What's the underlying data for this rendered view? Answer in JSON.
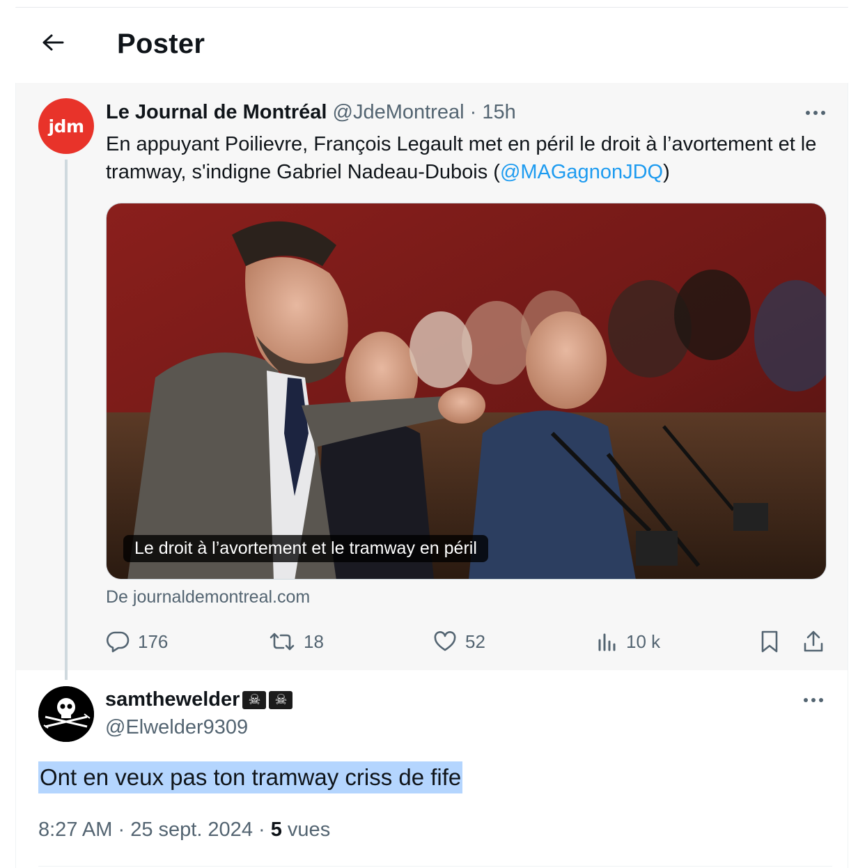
{
  "header": {
    "title": "Poster",
    "back_icon": "arrow-left-icon"
  },
  "parent_tweet": {
    "avatar_text": "jdm",
    "avatar_color": "#e8332a",
    "display_name": "Le Journal de Montréal",
    "handle": "@JdeMontreal",
    "separator": "·",
    "time": "15h",
    "text_before": "En appuyant Poilievre, François Legault met en péril le droit à l’avortement et le tramway, s'indigne Gabriel Nadeau-Dubois (",
    "mention": "@MAGagnonJDQ",
    "text_after": ")",
    "media_caption": "Le droit à l’avortement et le tramway en péril",
    "source": "De journaldemontreal.com",
    "actions": {
      "replies": "176",
      "reposts": "18",
      "likes": "52",
      "views": "10 k"
    }
  },
  "reply_tweet": {
    "display_name": "samthewelder",
    "flag_emoji": "☠",
    "handle": "@Elwelder9309",
    "text": "Ont en veux pas ton tramway criss de fife",
    "time": "8:27 AM",
    "sep1": " · ",
    "date": "25 sept. 2024",
    "sep2": " · ",
    "views_count": "5",
    "views_label": " vues"
  },
  "colors": {
    "link": "#1d9bf0",
    "muted": "#536471",
    "highlight": "#b4d5fe"
  }
}
